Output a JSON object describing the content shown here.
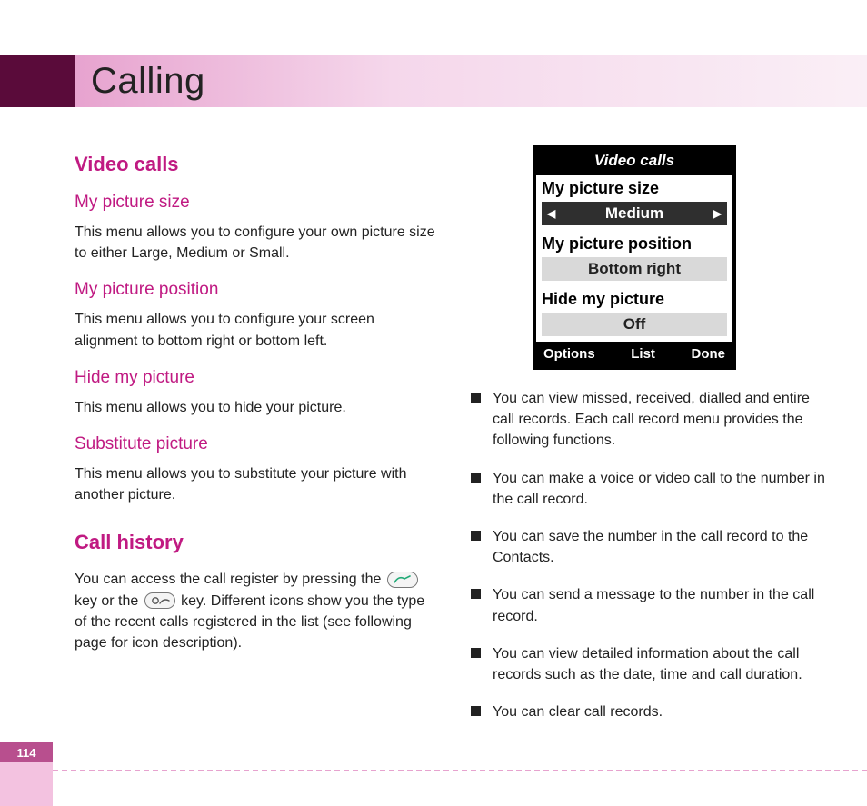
{
  "header": {
    "title": "Calling"
  },
  "left": {
    "section1": "Video calls",
    "sub1": "My picture size",
    "text1": "This menu allows you to configure your own picture size to either Large, Medium or Small.",
    "sub2": "My picture position",
    "text2": "This menu allows you to configure your screen alignment to bottom right or bottom left.",
    "sub3": "Hide my picture",
    "text3": "This menu allows you to hide your picture.",
    "sub4": "Substitute picture",
    "text4": "This menu allows you to substitute your picture with another picture.",
    "section2": "Call history",
    "text5a": "You can access the call register by pressing the ",
    "text5b": " key or the ",
    "text5c": " key. Different icons show you the type of the recent calls registered in the list (see following page for icon description)."
  },
  "phone": {
    "title": "Video calls",
    "rows": [
      {
        "label": "My picture size",
        "value": "Medium",
        "arrows": true
      },
      {
        "label": "My picture position",
        "value": "Bottom right",
        "arrows": false
      },
      {
        "label": "Hide my picture",
        "value": "Off",
        "arrows": false
      }
    ],
    "softkeys": {
      "left": "Options",
      "center": "List",
      "right": "Done"
    }
  },
  "right": {
    "bullets": [
      "You can view missed, received, dialled and entire call records. Each call record menu provides the following functions.",
      "You can make a voice or video call to the number in the call record.",
      "You can save the number in the call record to the Contacts.",
      "You can send a message to the number in the call record.",
      "You can view detailed information about the call records such as the date, time and call duration.",
      "You can clear call records."
    ]
  },
  "footer": {
    "page_number": "114"
  }
}
